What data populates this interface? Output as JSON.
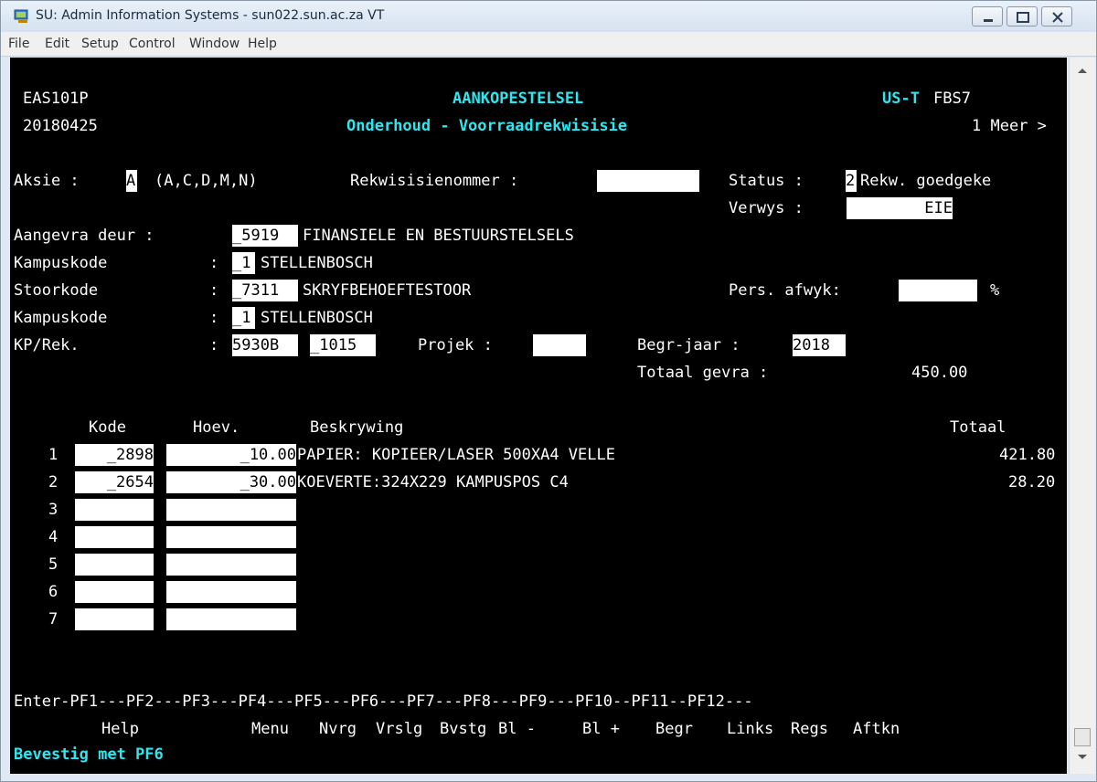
{
  "window": {
    "title": "SU: Admin Information Systems - sun022.sun.ac.za VT"
  },
  "menu": [
    "File",
    "Edit",
    "Setup",
    "Control",
    "Window",
    "Help"
  ],
  "header": {
    "program": "EAS101P",
    "date": "20180425",
    "system": "AANKOPESTELSEL",
    "subtitle": "Onderhoud - Voorraadrekwisisie",
    "env_label": "US-T",
    "env_code": "FBS7",
    "more": "1 Meer >"
  },
  "form": {
    "aksie_label": "Aksie :",
    "aksie_value": "A",
    "aksie_options": "(A,C,D,M,N)",
    "rekwisisie_label": "Rekwisisienommer :",
    "rekwisisie_value": "",
    "status_label": "Status :",
    "status_value": "2",
    "status_text": "Rekw. goedgeke",
    "verwys_label": "Verwys :",
    "verwys_value": "EIE",
    "aangevra_label": "Aangevra deur :",
    "aangevra_value": "_5919",
    "aangevra_text": "FINANSIELE EN BESTUURSTELSELS",
    "kampus1_label": "Kampuskode",
    "kampus1_value": "_1",
    "kampus1_text": "STELLENBOSCH",
    "stoor_label": "Stoorkode",
    "stoor_value": "_7311",
    "stoor_text": "SKRYFBEHOEFTESTOOR",
    "pers_label": "Pers. afwyk:",
    "pers_value": "",
    "pers_unit": "%",
    "kampus2_label": "Kampuskode",
    "kampus2_value": "_1",
    "kampus2_text": "STELLENBOSCH",
    "kp_label": "KP/Rek.",
    "kp_value1": "5930B",
    "kp_value2": "_1015",
    "projek_label": "Projek :",
    "projek_value": "",
    "begr_label": "Begr-jaar :",
    "begr_value": "2018",
    "totaal_label": "Totaal gevra :",
    "totaal_value": "450.00",
    "colon": ":"
  },
  "table": {
    "headers": {
      "kode": "Kode",
      "hoev": "Hoev.",
      "beskrywing": "Beskrywing",
      "totaal": "Totaal"
    },
    "rows": [
      {
        "num": "1",
        "kode": "_2898",
        "hoev": "_10.00",
        "beskrywing": "PAPIER: KOPIEER/LASER 500XA4 VELLE",
        "totaal": "421.80"
      },
      {
        "num": "2",
        "kode": "_2654",
        "hoev": "_30.00",
        "beskrywing": "KOEVERTE:324X229 KAMPUSPOS C4",
        "totaal": "28.20"
      },
      {
        "num": "3",
        "kode": "",
        "hoev": "",
        "beskrywing": "",
        "totaal": ""
      },
      {
        "num": "4",
        "kode": "",
        "hoev": "",
        "beskrywing": "",
        "totaal": ""
      },
      {
        "num": "5",
        "kode": "",
        "hoev": "",
        "beskrywing": "",
        "totaal": ""
      },
      {
        "num": "6",
        "kode": "",
        "hoev": "",
        "beskrywing": "",
        "totaal": ""
      },
      {
        "num": "7",
        "kode": "",
        "hoev": "",
        "beskrywing": "",
        "totaal": ""
      }
    ]
  },
  "footer": {
    "pf_line": "Enter-PF1---PF2---PF3---PF4---PF5---PF6---PF7---PF8---PF9---PF10--PF11--PF12---",
    "keys": [
      {
        "label": "Help"
      },
      {
        "label": "Menu"
      },
      {
        "label": "Nvrg"
      },
      {
        "label": "Vrslg"
      },
      {
        "label": "Bvstg"
      },
      {
        "label": "Bl -"
      },
      {
        "label": "Bl +"
      },
      {
        "label": "Begr"
      },
      {
        "label": "Links"
      },
      {
        "label": "Regs"
      },
      {
        "label": "Aftkn"
      }
    ],
    "message": "Bevestig met PF6"
  },
  "colors": {
    "terminal_bg": "#000000",
    "terminal_fg": "#ffffff",
    "highlight_cyan": "#2ee6f0",
    "field_bg": "#ffffff"
  }
}
